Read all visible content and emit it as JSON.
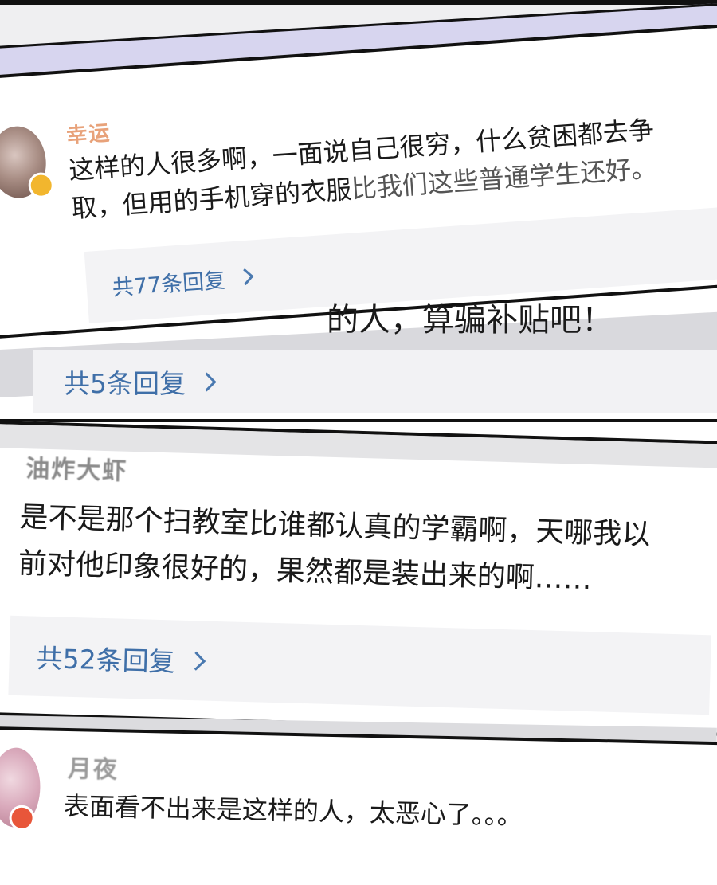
{
  "comments": [
    {
      "username": "幸运",
      "text_line1": "这样的人很多啊，一面说自己很穷，什么贫困都去争",
      "text_line2a": "取，但用的手机穿的衣服",
      "text_line2b": "比我们这些普通学生还好。",
      "replies": "共77条回复",
      "username_color": "#e8a27a",
      "badge_color": "#f2b62e"
    },
    {
      "partial_text": "的人，算骗补贴吧！",
      "replies": "共5条回复"
    },
    {
      "username": "油炸大虾",
      "text_line1": "是不是那个扫教室比谁都认真的学霸啊，天哪我以",
      "text_line2": "前对他印象很好的，果然都是装出来的啊……",
      "replies": "共52条回复",
      "username_color": "#8a8a8a"
    },
    {
      "username": "月夜",
      "text": "表面看不出来是这样的人，太恶心了。。。",
      "username_color": "#9a9a9a",
      "badge_color": "#e8563a"
    }
  ],
  "icons": {
    "chevron": "chevron-right-icon",
    "verified": "verified-badge-icon",
    "member": "member-badge-icon"
  },
  "colors": {
    "stripe": "#d7d5ef",
    "reply_link": "#3f6fa8"
  }
}
